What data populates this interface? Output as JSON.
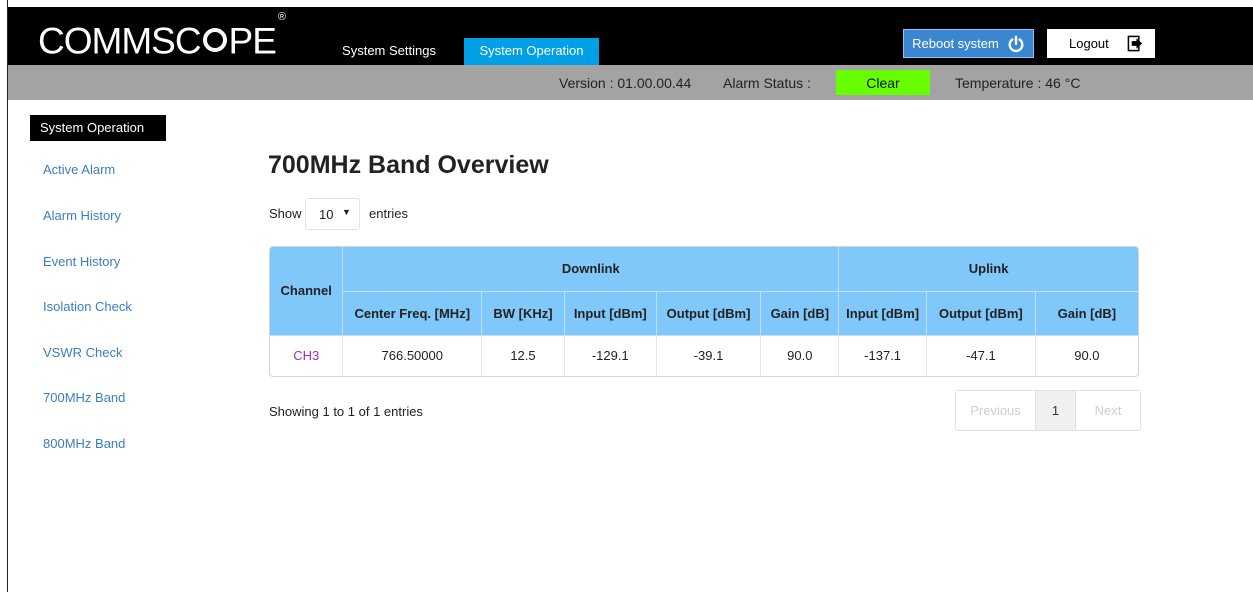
{
  "header": {
    "logo_text": "COMMSC",
    "logo_text_tail": "PE",
    "logo_mark": "®",
    "tabs": [
      {
        "label": "System Settings",
        "active": false
      },
      {
        "label": "System Operation",
        "active": true
      }
    ],
    "reboot_label": "Reboot system",
    "reboot_icon": "power-icon",
    "logout_label": "Logout",
    "logout_icon": "logout-icon"
  },
  "status": {
    "version": "Version : 01.00.00.44",
    "alarm_label": "Alarm Status :",
    "alarm_value": "Clear",
    "alarm_color": "#66ff00",
    "temperature": "Temperature : 46 °C"
  },
  "sidebar": {
    "title": "System Operation",
    "items": [
      {
        "label": "Active Alarm"
      },
      {
        "label": "Alarm History"
      },
      {
        "label": "Event History"
      },
      {
        "label": "Isolation Check"
      },
      {
        "label": "VSWR Check"
      },
      {
        "label": "700MHz Band"
      },
      {
        "label": "800MHz Band"
      }
    ]
  },
  "main": {
    "title": "700MHz Band Overview",
    "show_label": "Show",
    "entries_value": "10",
    "entries_label": "entries",
    "table": {
      "channel_header": "Channel",
      "downlink_header": "Downlink",
      "uplink_header": "Uplink",
      "columns": [
        "Center Freq. [MHz]",
        "BW [KHz]",
        "Input [dBm]",
        "Output [dBm]",
        "Gain [dB]",
        "Input [dBm]",
        "Output [dBm]",
        "Gain [dB]"
      ],
      "rows": [
        {
          "channel": "CH3",
          "cells": [
            "766.50000",
            "12.5",
            "-129.1",
            "-39.1",
            "90.0",
            "-137.1",
            "-47.1",
            "90.0"
          ]
        }
      ]
    },
    "info": "Showing 1 to 1 of 1 entries",
    "pager": {
      "previous": "Previous",
      "current": "1",
      "next": "Next"
    }
  }
}
